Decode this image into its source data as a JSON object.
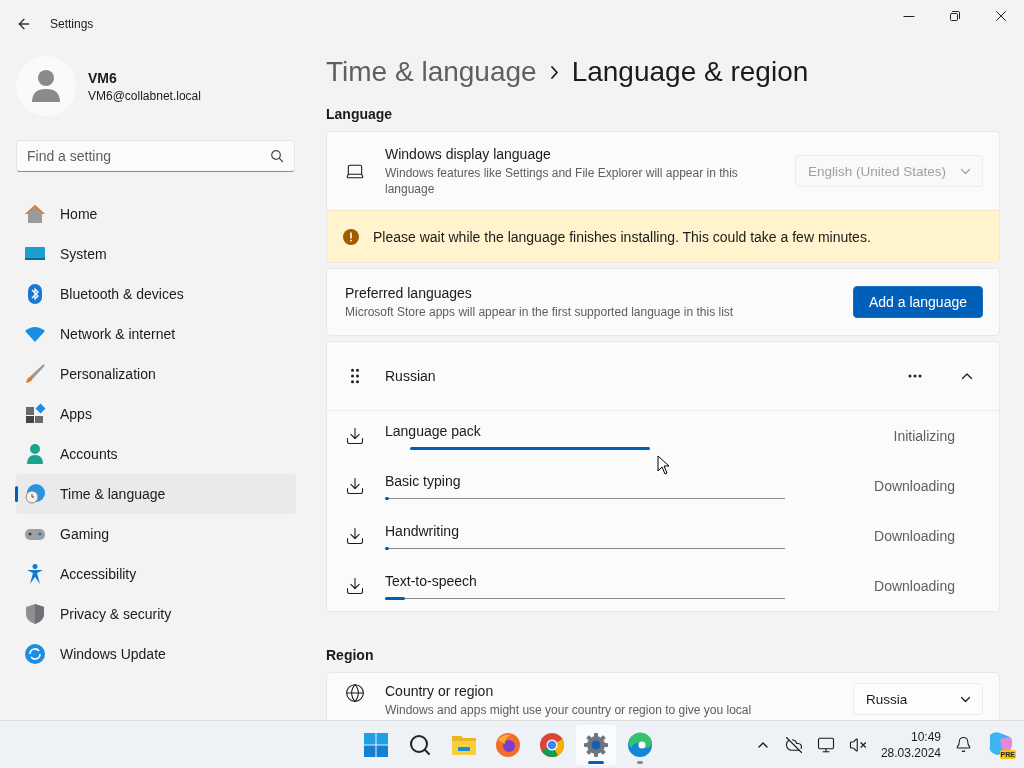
{
  "window": {
    "title": "Settings"
  },
  "profile": {
    "name": "VM6",
    "email": "VM6@collabnet.local"
  },
  "search": {
    "placeholder": "Find a setting"
  },
  "sidebar": {
    "items": [
      {
        "label": "Home",
        "selected": false
      },
      {
        "label": "System",
        "selected": false
      },
      {
        "label": "Bluetooth & devices",
        "selected": false
      },
      {
        "label": "Network & internet",
        "selected": false
      },
      {
        "label": "Personalization",
        "selected": false
      },
      {
        "label": "Apps",
        "selected": false
      },
      {
        "label": "Accounts",
        "selected": false
      },
      {
        "label": "Time & language",
        "selected": true
      },
      {
        "label": "Gaming",
        "selected": false
      },
      {
        "label": "Accessibility",
        "selected": false
      },
      {
        "label": "Privacy & security",
        "selected": false
      },
      {
        "label": "Windows Update",
        "selected": false
      }
    ]
  },
  "breadcrumb": {
    "parent": "Time & language",
    "current": "Language & region"
  },
  "language_section": {
    "heading": "Language",
    "display_language": {
      "title": "Windows display language",
      "description": "Windows features like Settings and File Explorer will appear in this language",
      "value": "English (United States)",
      "disabled": true
    },
    "notice": "Please wait while the language finishes installing. This could take a few minutes.",
    "preferred": {
      "title": "Preferred languages",
      "description": "Microsoft Store apps will appear in the first supported language in this list",
      "button": "Add a language"
    },
    "language": {
      "name": "Russian",
      "expanded": true,
      "features": [
        {
          "name": "Language pack",
          "status": "Initializing",
          "kind": "indeterminate"
        },
        {
          "name": "Basic typing",
          "status": "Downloading",
          "kind": "determinate",
          "level": 0.01
        },
        {
          "name": "Handwriting",
          "status": "Downloading",
          "kind": "determinate",
          "level": 0.01
        },
        {
          "name": "Text-to-speech",
          "status": "Downloading",
          "kind": "determinate",
          "level": 0.05
        }
      ]
    }
  },
  "region_section": {
    "heading": "Region",
    "country": {
      "title": "Country or region",
      "description": "Windows and apps might use your country or region to give you local",
      "value": "Russia"
    }
  },
  "taskbar": {
    "apps": [
      {
        "selected": false,
        "running": false
      },
      {
        "selected": false,
        "running": false
      },
      {
        "selected": false,
        "running": false
      },
      {
        "selected": false,
        "running": false
      },
      {
        "selected": false,
        "running": false
      },
      {
        "selected": true,
        "running": true
      },
      {
        "selected": false,
        "running": true
      }
    ],
    "clock": {
      "time": "10:49",
      "date": "28.03.2024"
    },
    "copilot_badge": "PRE"
  }
}
